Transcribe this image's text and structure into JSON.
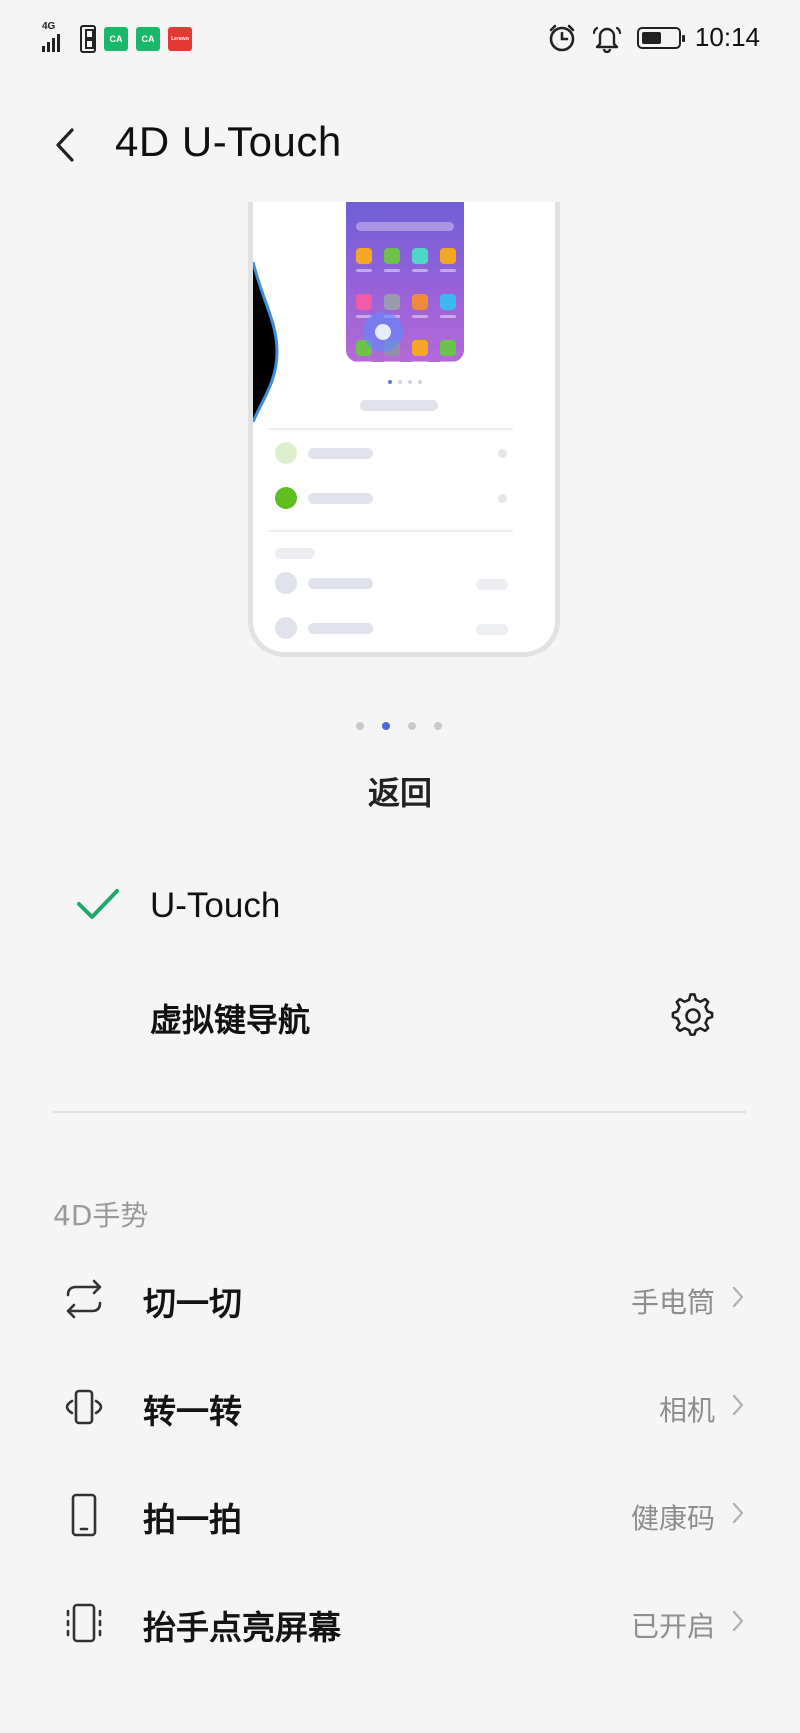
{
  "status_bar": {
    "network": "4G",
    "app_icons": [
      "CA",
      "CA",
      "Lenovo"
    ],
    "time": "10:14",
    "icons": [
      "alarm-icon",
      "bell-icon",
      "battery-icon"
    ]
  },
  "header": {
    "title": "4D U-Touch",
    "back_icon": "back-arrow-icon"
  },
  "illustration": {
    "pager_count": 4,
    "pager_active_index": 1,
    "caption": "返回"
  },
  "navigation_options": [
    {
      "label": "U-Touch",
      "selected": true
    },
    {
      "label": "虚拟键导航",
      "selected": false,
      "has_settings": true
    }
  ],
  "gestures": {
    "section_title": "4D手势",
    "items": [
      {
        "label": "切一切",
        "value": "手电筒",
        "icon": "swap-arrows-icon"
      },
      {
        "label": "转一转",
        "value": "相机",
        "icon": "rotate-phone-icon"
      },
      {
        "label": "拍一拍",
        "value": "健康码",
        "icon": "phone-tap-icon"
      },
      {
        "label": "抬手点亮屏幕",
        "value": "已开启",
        "icon": "raise-wake-icon"
      }
    ]
  },
  "colors": {
    "accent_check": "#1fa86a",
    "pager_active": "#4f6ad7",
    "background": "#f5f5f5"
  }
}
